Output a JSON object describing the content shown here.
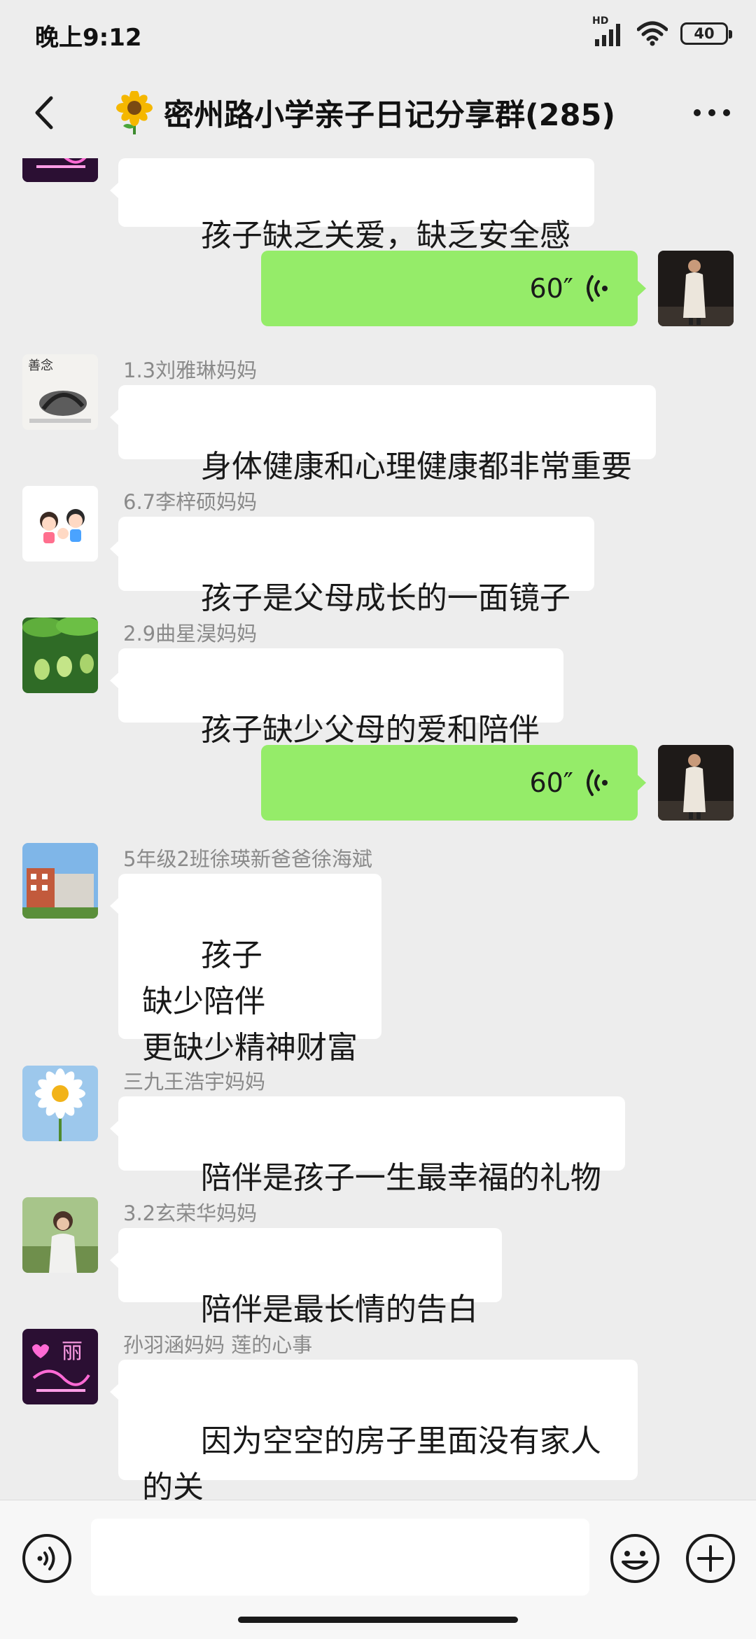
{
  "status_bar": {
    "time": "晚上9:12",
    "network_badge": "HD",
    "battery": "40"
  },
  "header": {
    "group_icon": "sunflower-icon",
    "title": "密州路小学亲子日记分享群(285)"
  },
  "messages": [
    {
      "id": "m0",
      "side": "left",
      "avatar_icon": "neon-sign-avatar-icon",
      "sender": "",
      "text": "孩子缺乏关爱，缺乏安全感"
    },
    {
      "id": "m1",
      "side": "right",
      "type": "voice",
      "duration": "60″",
      "avatar_icon": "standing-person-avatar-icon"
    },
    {
      "id": "m2",
      "side": "left",
      "avatar_icon": "calligraphy-avatar-icon",
      "sender": "1.3刘雅琳妈妈",
      "text": "身体健康和心理健康都非常重要"
    },
    {
      "id": "m3",
      "side": "left",
      "avatar_icon": "cartoon-family-avatar-icon",
      "sender": "6.7李梓硕妈妈",
      "text": "孩子是父母成长的一面镜子"
    },
    {
      "id": "m4",
      "side": "left",
      "avatar_icon": "green-plant-avatar-icon",
      "sender": "2.9曲星淏妈妈",
      "text": "孩子缺少父母的爱和陪伴"
    },
    {
      "id": "m5",
      "side": "right",
      "type": "voice",
      "duration": "60″",
      "avatar_icon": "standing-person-avatar-icon"
    },
    {
      "id": "m6",
      "side": "left",
      "avatar_icon": "school-building-avatar-icon",
      "sender": "5年级2班徐瑛新爸爸徐海斌",
      "text": "孩子\n缺少陪伴\n更缺少精神财富"
    },
    {
      "id": "m7",
      "side": "left",
      "avatar_icon": "daisy-avatar-icon",
      "sender": "三九王浩宇妈妈",
      "text": "陪伴是孩子一生最幸福的礼物"
    },
    {
      "id": "m8",
      "side": "left",
      "avatar_icon": "woman-portrait-avatar-icon",
      "sender": "3.2玄荣华妈妈",
      "text": "陪伴是最长情的告白"
    },
    {
      "id": "m9",
      "side": "left",
      "avatar_icon": "neon-sign-avatar-icon",
      "sender": "孙羽涵妈妈  莲的心事",
      "text": "因为空空的房子里面没有家人的关\n爱"
    }
  ],
  "neon_avatar_text": "丽",
  "calligraphy_avatar_text": "善念",
  "input_bar": {
    "placeholder": "",
    "value": ""
  },
  "colors": {
    "background": "#ededed",
    "incoming_bubble": "#ffffff",
    "outgoing_bubble": "#95ec69",
    "sender_name": "#8a8a8a"
  }
}
